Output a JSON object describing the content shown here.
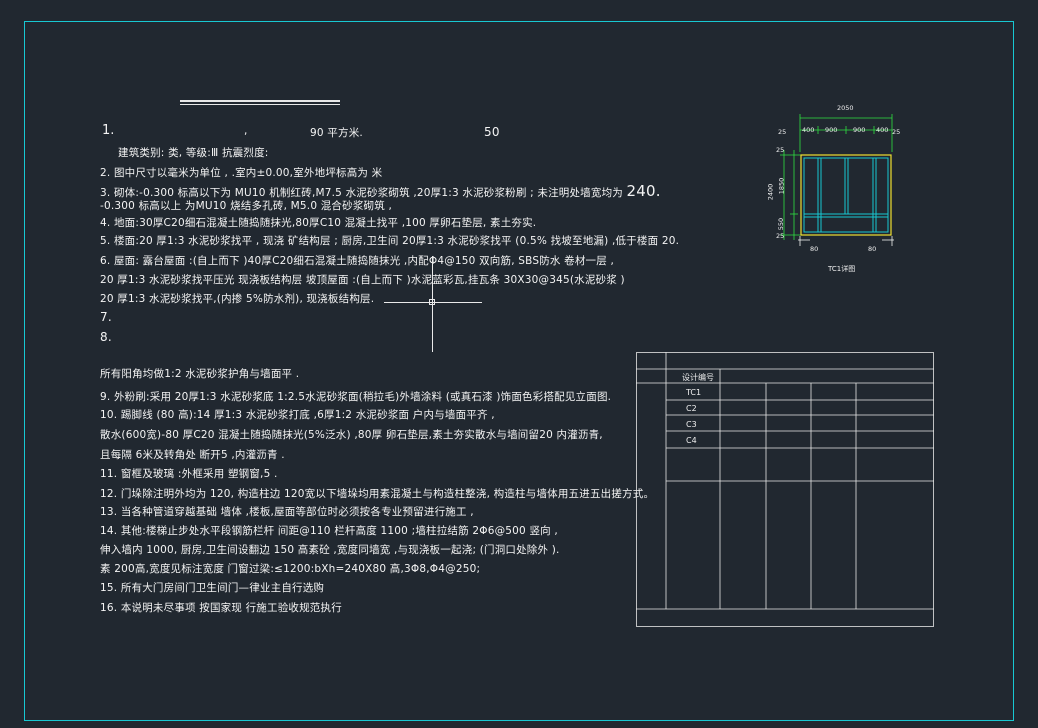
{
  "notes": {
    "n1_num": "1.",
    "n1_comma": ",",
    "n1_area": "90 平方米.",
    "n1_extra": "50",
    "n1b": "建筑类别:     类,            等级:Ⅲ   抗震烈度:",
    "n2": "2.  图中尺寸以毫米为单位            ,                   .室内±0.00,室外地坪标高为        米",
    "n3a_prefix": "3.  砌体:-0.300  标高以下为  MU10 机制红砖,M7.5 水泥砂浆砌筑 ,20厚1:3 水泥砂浆粉刷 ; 未注明处墙宽均为",
    "n3a_big": "240.",
    "n3b": "     -0.300  标高以上  为MU10 烧结多孔砖,  M5.0 混合砂浆砌筑 ,",
    "n4": "4.  地面:30厚C20细石混凝土随捣随抹光,80厚C10 混凝土找平 ,100 厚卵石垫层, 素土夯实.",
    "n5": "5.  楼面:20 厚1:3 水泥砂浆找平 , 现浇 矿结构层 ; 厨房,卫生间 20厚1:3 水泥砂浆找平 (0.5% 找坡至地漏) ,低于楼面 20.",
    "n6a": "6.  屋面: 露台屋面 :(自上而下 )40厚C20细石混凝土随捣随抹光  ,内配Φ4@150 双向筋, SBS防水 卷材一层 ,",
    "n6b": "     20 厚1:3 水泥砂浆找平压光 现浇板结构层 坡顶屋面 :(自上而下 )水泥蓝彩瓦,挂瓦条 30X30@345(水泥砂浆 )",
    "n6c": "     20 厚1:3 水泥砂浆找平,(内掺 5%防水剂), 现浇板结构层.",
    "n7": "7.",
    "n8": "8.",
    "n8b": "     所有阳角均做1:2 水泥砂浆护角与墙面平 .",
    "n9": "9.  外粉刷:采用 20厚1:3 水泥砂浆底 1:2.5水泥砂浆面(稍拉毛)外墙涂料 (或真石漆 )饰面色彩搭配见立面图.",
    "n10a": "10.  踢脚线 (80 高):14 厚1:3 水泥砂浆打底 ,6厚1:2 水泥砂浆面  户内与墙面平齐 ,",
    "n10b": "      散水(600宽)-80 厚C20 混凝土随捣随抹光(5%泛水) ,80厚 卵石垫层,素土夯实散水与墙间留20 内灌沥青,",
    "n10c": "      且每隔 6米及转角处  断开5 ,内灌沥青 .",
    "n11": "11.  窗框及玻璃 :外框采用  塑钢窗,5        .",
    "n12": "12.  门垛除注明外均为  120, 构造柱边 120宽以下墙垛均用素混凝土与构造柱整浇, 构造柱与墙体用五进五出搓方式。",
    "n13": "13.  当各种管道穿越基础   墙体 ,楼板,屋面等部位时必须按各专业预留进行施工 ,",
    "n14a": "14.  其他:楼梯止步处水平段钢筋栏杆 间距@110   栏杆高度 1100 ;墙柱拉结筋 2Φ6@500 竖向 ,",
    "n14b": "      伸入墙内 1000, 厨房,卫生间设翻边  150 高素砼 ,宽度同墙宽 ,与现浇板一起浇; (门洞口处除外  ).",
    "n14c": "                          素           200高,宽度见标注宽度 门窗过梁:≤1200:bXh=240X80 高,3Φ8,Φ4@250;",
    "n15": "15.  所有大门房间门卫生间门—律业主自行选购",
    "n16": "16.  本说明未尽事项 按国家现  行施工验收规范执行"
  },
  "window_detail": {
    "top_total": "2050",
    "top_segments": [
      "400",
      "900",
      "900",
      "400"
    ],
    "left_edge_top": "25",
    "right_edge_top": "25",
    "left_total": "2400",
    "left_upper": "1850",
    "left_lower": "550",
    "left_top_small": "25",
    "left_bottom_small": "25",
    "bottom_left": "80",
    "bottom_right": "80",
    "caption": "TC1详图"
  },
  "table": {
    "header": "设计编号",
    "codes": [
      "TC1",
      "C2",
      "C3",
      "C4"
    ]
  },
  "colors": {
    "background": "#212830",
    "frame": "#18c8d2",
    "text": "#f4f4f4",
    "window_frame": "#f0e030",
    "window_inner": "#18c8d2",
    "dimension": "#2fe040"
  }
}
